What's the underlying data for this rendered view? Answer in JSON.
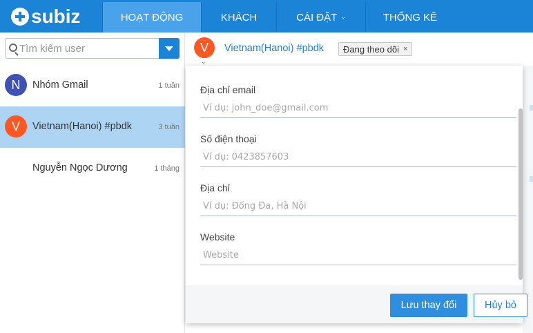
{
  "app": {
    "logo_text": "subiz"
  },
  "nav": {
    "items": [
      {
        "label": "HOẠT ĐỘNG",
        "active": true
      },
      {
        "label": "KHÁCH",
        "active": false
      },
      {
        "label": "CÀI ĐẶT",
        "active": false,
        "has_dropdown": true,
        "chevron": "⌄"
      },
      {
        "label": "THỐNG KÊ",
        "active": false
      }
    ]
  },
  "sidebar": {
    "search": {
      "placeholder": "Tìm kiếm user",
      "value": ""
    },
    "conversations": [
      {
        "initial": "N",
        "name": "Nhóm Gmail",
        "time": "1 tuần",
        "avatar_color": "#3f51b5",
        "selected": false
      },
      {
        "initial": "V",
        "name": "Vietnam(Hanoi) #pbdk",
        "time": "3 tuần",
        "avatar_color": "#ff5722",
        "selected": true
      },
      {
        "initial": "",
        "name": "Nguyễn Ngọc Dương",
        "time": "1 tháng",
        "avatar_color": "",
        "selected": false
      }
    ]
  },
  "header": {
    "initial": "V",
    "avatar_color": "#ff5722",
    "chevron": "⌄",
    "name": "Vietnam(Hanoi) #pbdk",
    "badge": {
      "label": "Đang theo dõi",
      "close": "×"
    }
  },
  "form": {
    "fields": [
      {
        "label": "Địa chỉ email",
        "placeholder": "Ví dụ: john_doe@gmail.com",
        "value": ""
      },
      {
        "label": "Số điện thoại",
        "placeholder": "Ví dụ: 0423857603",
        "value": ""
      },
      {
        "label": "Địa chỉ",
        "placeholder": "Ví dụ: Đống Đa, Hà Nội",
        "value": ""
      },
      {
        "label": "Website",
        "placeholder": "Website",
        "value": ""
      }
    ],
    "save_label": "Lưu thay đổi",
    "cancel_label": "Hủy bỏ"
  },
  "colors": {
    "brand": "#1b84d6",
    "nav_active": "#4aa3ea",
    "selected_row": "#aed4f4",
    "primary_button": "#2e8ee0"
  }
}
